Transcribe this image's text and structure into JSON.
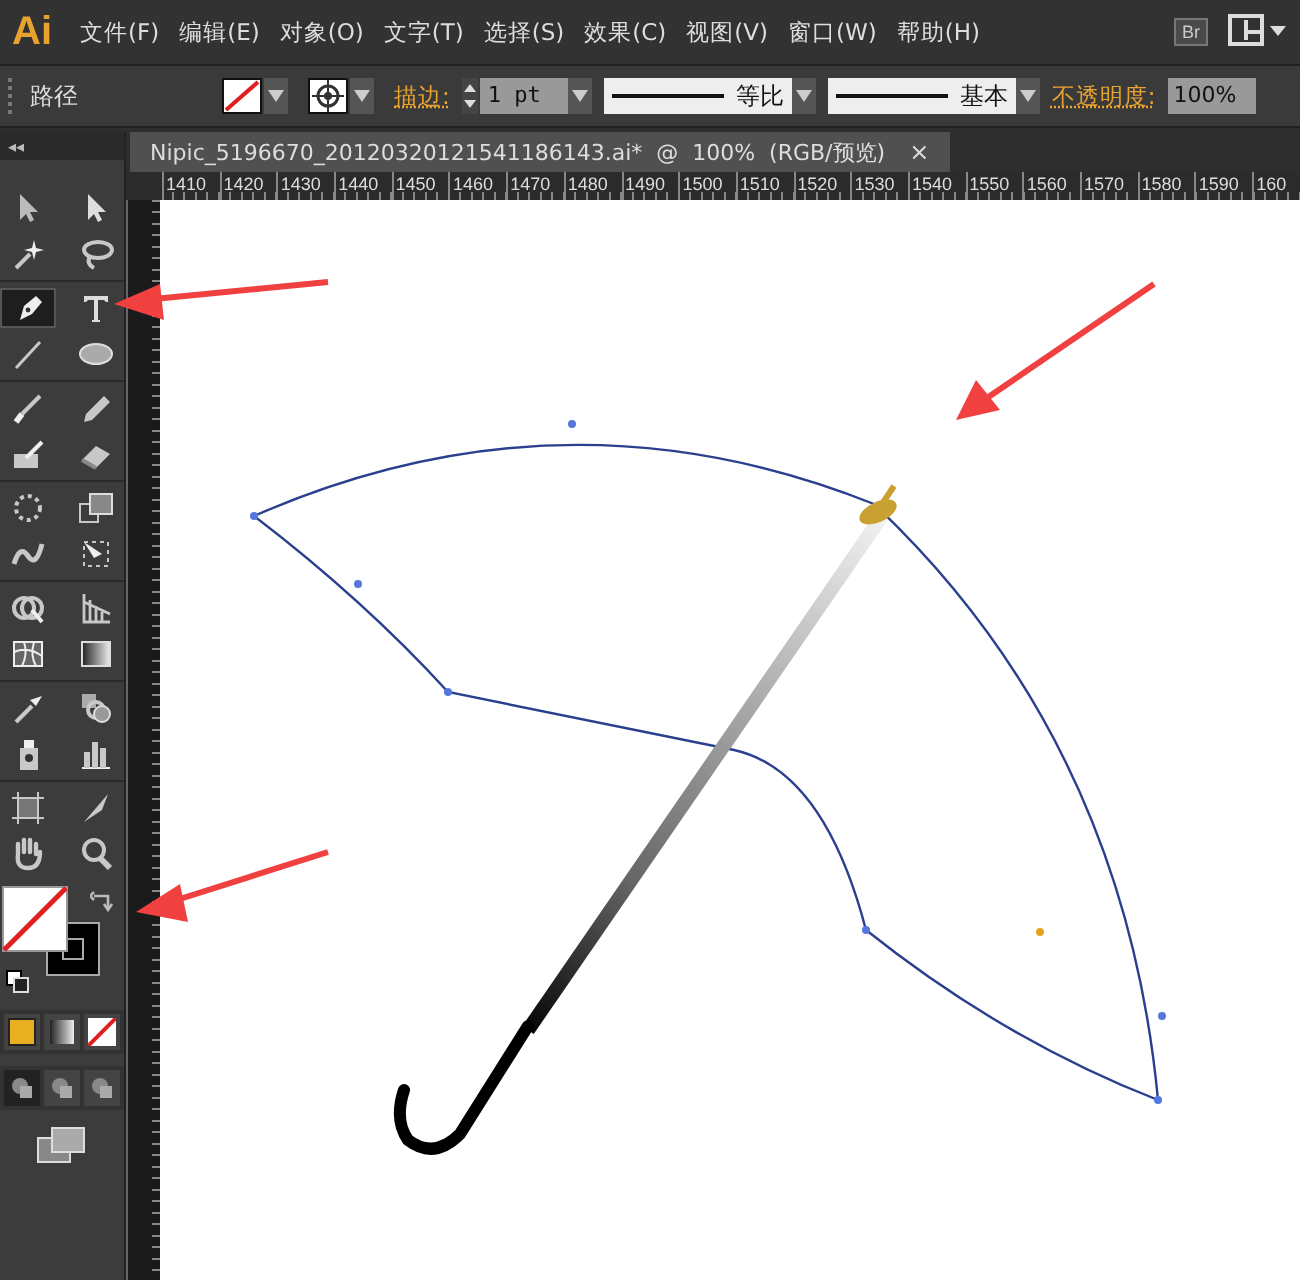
{
  "app": {
    "logo": "Ai",
    "bridge_button": "Br"
  },
  "menu": [
    "文件(F)",
    "编辑(E)",
    "对象(O)",
    "文字(T)",
    "选择(S)",
    "效果(C)",
    "视图(V)",
    "窗口(W)",
    "帮助(H)"
  ],
  "control_bar": {
    "selection_label": "路径",
    "stroke_label": "描边:",
    "stroke_weight": "1 pt",
    "profile": "等比",
    "brush": "基本",
    "opacity_label": "不透明度:",
    "opacity": "100%"
  },
  "panel_collapse": "◂◂",
  "document_tab": {
    "title": "Nipic_5196670_20120320121541186143.ai*  @  100%  (RGB/预览)",
    "close": "×",
    "selected": true
  },
  "ruler_labels": [
    "1410",
    "1420",
    "1430",
    "1440",
    "1450",
    "1460",
    "1470",
    "1480",
    "1490",
    "1500",
    "1510",
    "1520",
    "1530",
    "1540",
    "1550",
    "1560",
    "1570",
    "1580",
    "1590",
    "160"
  ],
  "tools": [
    {
      "kind": "select",
      "selected": false
    },
    {
      "kind": "direct",
      "selected": false
    },
    {
      "kind": "wand",
      "selected": false
    },
    {
      "kind": "lasso",
      "selected": false
    },
    {
      "kind": "pen",
      "selected": true
    },
    {
      "kind": "type",
      "selected": false
    },
    {
      "kind": "line",
      "selected": false
    },
    {
      "kind": "ellipse",
      "selected": false
    },
    {
      "kind": "brush",
      "selected": false
    },
    {
      "kind": "pencil",
      "selected": false
    },
    {
      "kind": "blob",
      "selected": false
    },
    {
      "kind": "eraser",
      "selected": false
    },
    {
      "kind": "rotate",
      "selected": false
    },
    {
      "kind": "scale",
      "selected": false
    },
    {
      "kind": "warp",
      "selected": false
    },
    {
      "kind": "transform",
      "selected": false
    },
    {
      "kind": "builder",
      "selected": false
    },
    {
      "kind": "perspective",
      "selected": false
    },
    {
      "kind": "mesh",
      "selected": false
    },
    {
      "kind": "gradient",
      "selected": false
    },
    {
      "kind": "eyedropper",
      "selected": false
    },
    {
      "kind": "blend",
      "selected": false
    },
    {
      "kind": "sprayer",
      "selected": false
    },
    {
      "kind": "graph",
      "selected": false
    },
    {
      "kind": "artboard",
      "selected": false
    },
    {
      "kind": "slice",
      "selected": false
    },
    {
      "kind": "hand",
      "selected": false
    },
    {
      "kind": "zoom",
      "selected": false
    }
  ],
  "fill_none": true,
  "draw_modes": [
    {
      "selected": true
    },
    {
      "selected": false
    },
    {
      "selected": false
    }
  ]
}
